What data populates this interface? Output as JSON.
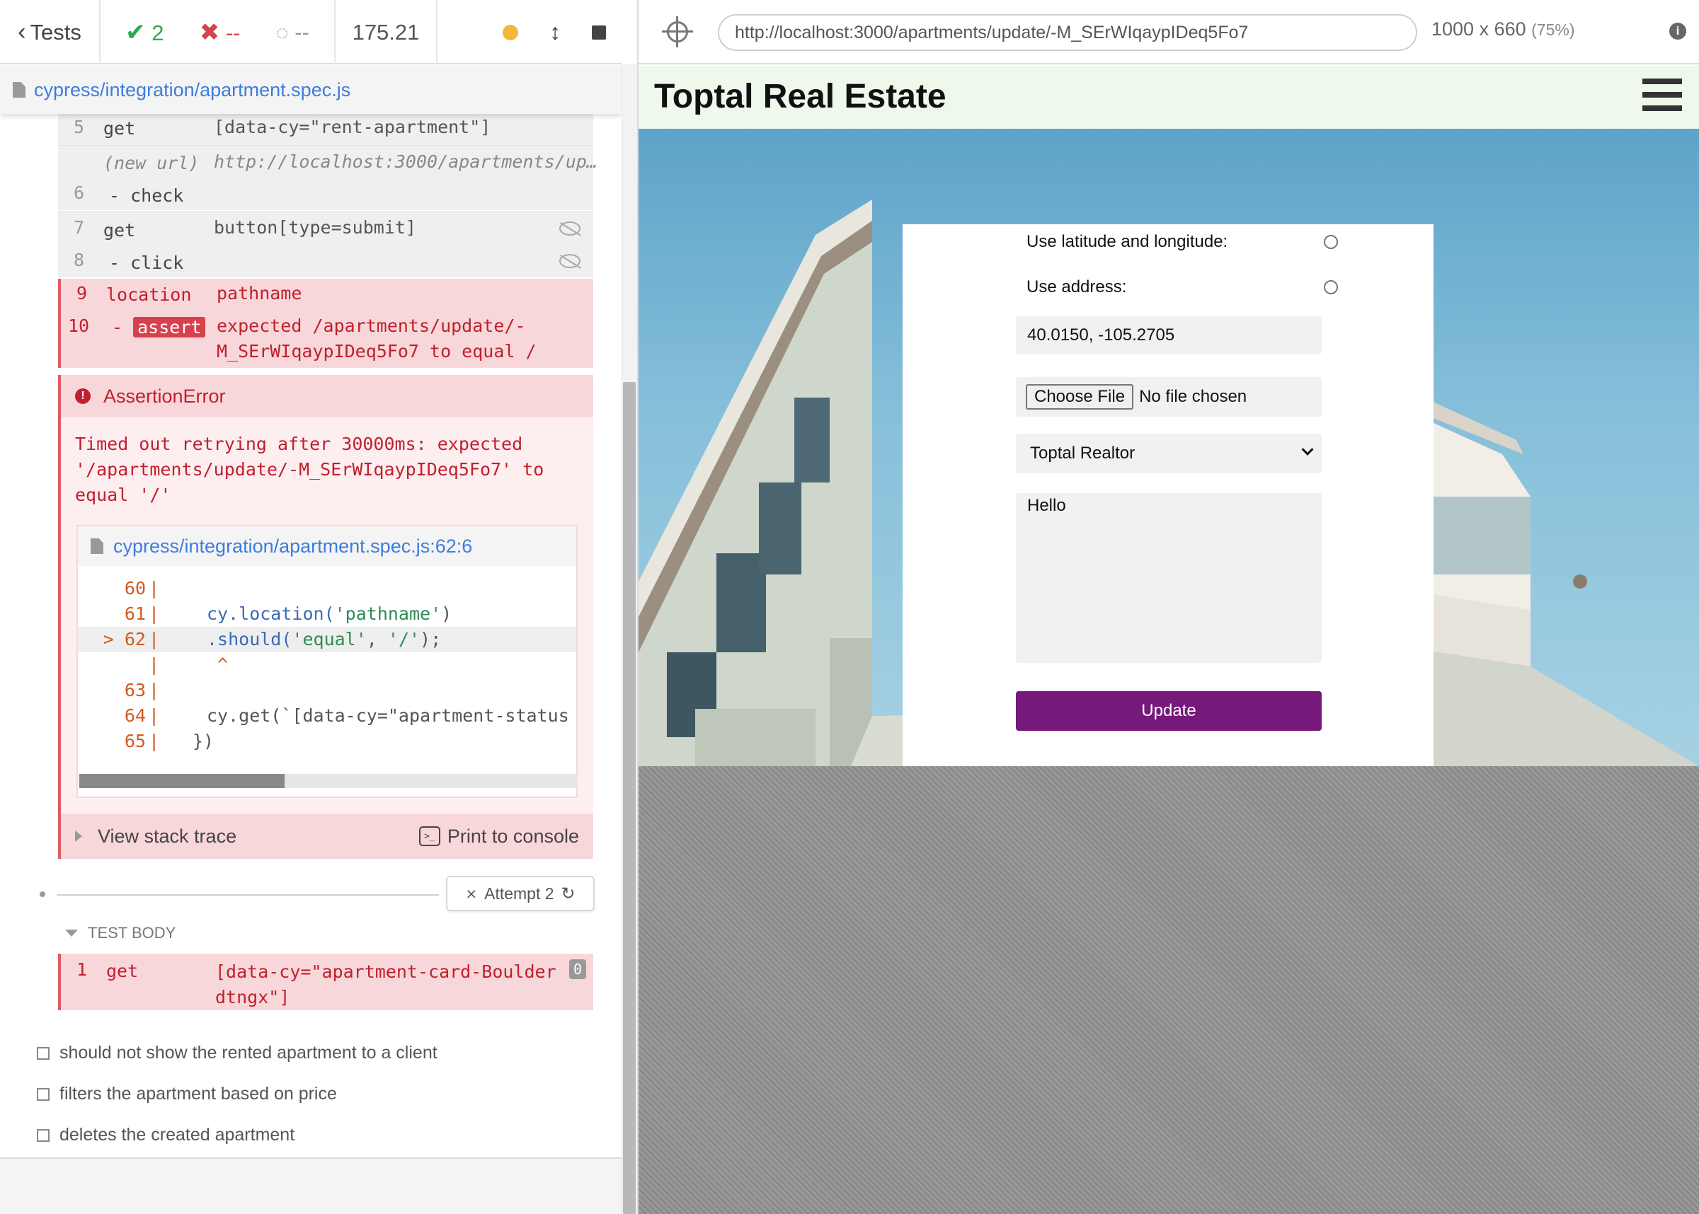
{
  "reporter": {
    "tests_label": "Tests",
    "passed": "2",
    "failed": "--",
    "pending": "--",
    "duration": "175.21",
    "spec_file": "cypress/integration/apartment.spec.js",
    "commands": [
      {
        "num": "5",
        "name": "get",
        "message": "[data-cy=\"rent-apartment\"]"
      },
      {
        "num": "",
        "name": "(new url)",
        "message": "http://localhost:3000/apartments/up…"
      },
      {
        "num": "6",
        "name": "- check",
        "message": ""
      },
      {
        "num": "7",
        "name": "get",
        "message": "button[type=submit]"
      },
      {
        "num": "8",
        "name": "- click",
        "message": ""
      },
      {
        "num": "9",
        "name": "location",
        "message": "pathname"
      },
      {
        "num": "10",
        "name": "assert",
        "message_line1": "expected /apartments/update/-",
        "message_line2": "M_SErWIqaypIDeq5Fo7 to equal /"
      }
    ],
    "error": {
      "title": "AssertionError",
      "message": "Timed out retrying after 30000ms: expected\n'/apartments/update/-M_SErWIqaypIDeq5Fo7' to\nequal '/'",
      "code_file": "cypress/integration/apartment.spec.js:62:6",
      "code_lines": [
        {
          "ln": "60",
          "src": ""
        },
        {
          "ln": "61",
          "src": "cy.location('pathname')"
        },
        {
          "ln": "> 62",
          "src": ".should('equal', '/');"
        },
        {
          "ln": "",
          "src": " ^"
        },
        {
          "ln": "63",
          "src": ""
        },
        {
          "ln": "64",
          "src": "cy.get(`[data-cy=\"apartment-status"
        },
        {
          "ln": "65",
          "src": "})"
        }
      ],
      "view_stack": "View stack trace",
      "print_console": "Print to console"
    },
    "attempt_label": "Attempt 2",
    "test_body_label": "TEST BODY",
    "body_command": {
      "num": "1",
      "name": "get",
      "message": "[data-cy=\"apartment-card-Boulder\ndtngx\"]",
      "count": "0"
    },
    "other_tests": [
      "should not show the rented apartment to a client",
      "filters the apartment based on price",
      "deletes the created apartment"
    ]
  },
  "aut": {
    "url": "http://localhost:3000/apartments/update/-M_SErWIqaypIDeq5Fo7",
    "viewport": "1000 x 660",
    "zoom": "(75%)",
    "app_title": "Toptal Real Estate",
    "form": {
      "use_latlng_label": "Use latitude and longitude:",
      "use_address_label": "Use address:",
      "coords_value": "40.0150, -105.2705",
      "file_button": "Choose File",
      "file_status": "No file chosen",
      "realtor_selected": "Toptal Realtor",
      "description_value": "Hello",
      "update_button": "Update"
    },
    "colors": {
      "accent": "#76197b",
      "app_bar": "#eef9ec"
    }
  }
}
